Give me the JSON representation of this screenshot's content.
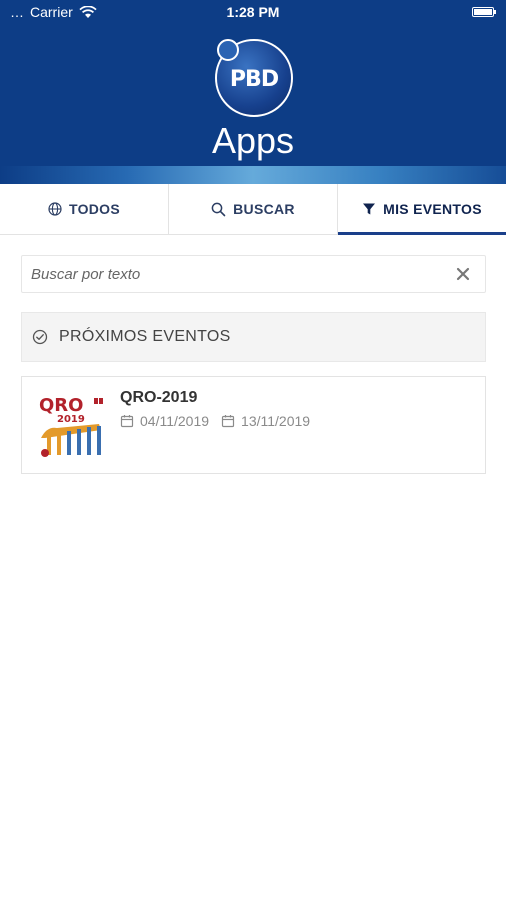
{
  "status_bar": {
    "carrier": "Carrier",
    "time": "1:28 PM"
  },
  "header": {
    "logo_text": "PBD",
    "app_title": "Apps"
  },
  "tabs": [
    {
      "label": "TODOS",
      "icon": "globe-icon"
    },
    {
      "label": "BUSCAR",
      "icon": "search-icon"
    },
    {
      "label": "MIS EVENTOS",
      "icon": "filter-icon",
      "active": true
    }
  ],
  "search": {
    "placeholder": "Buscar por texto"
  },
  "section": {
    "title": "PRÓXIMOS EVENTOS"
  },
  "events": [
    {
      "title": "QRO-2019",
      "start_date": "04/11/2019",
      "end_date": "13/11/2019",
      "thumb": {
        "line1": "QRO",
        "line2": "2019"
      }
    }
  ],
  "colors": {
    "brand": "#0d3d86",
    "accent": "#1a3f8a"
  }
}
